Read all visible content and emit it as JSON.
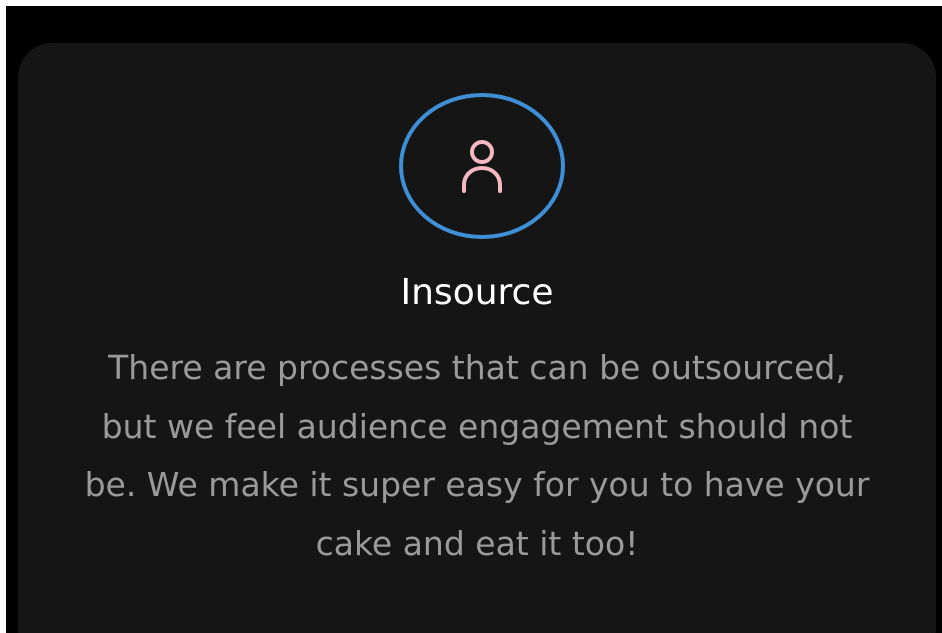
{
  "card": {
    "icon": "user-icon",
    "title": "Insource",
    "description": "There are processes that can be outsourced, but we feel audience engagement should not be. We make it super easy for you to have your cake and eat it too!"
  },
  "colors": {
    "background": "#000000",
    "card": "#151515",
    "ring": "#3f8fd6",
    "icon": "#f4b8c0",
    "title": "#ffffff",
    "text": "#9a9a9a"
  }
}
